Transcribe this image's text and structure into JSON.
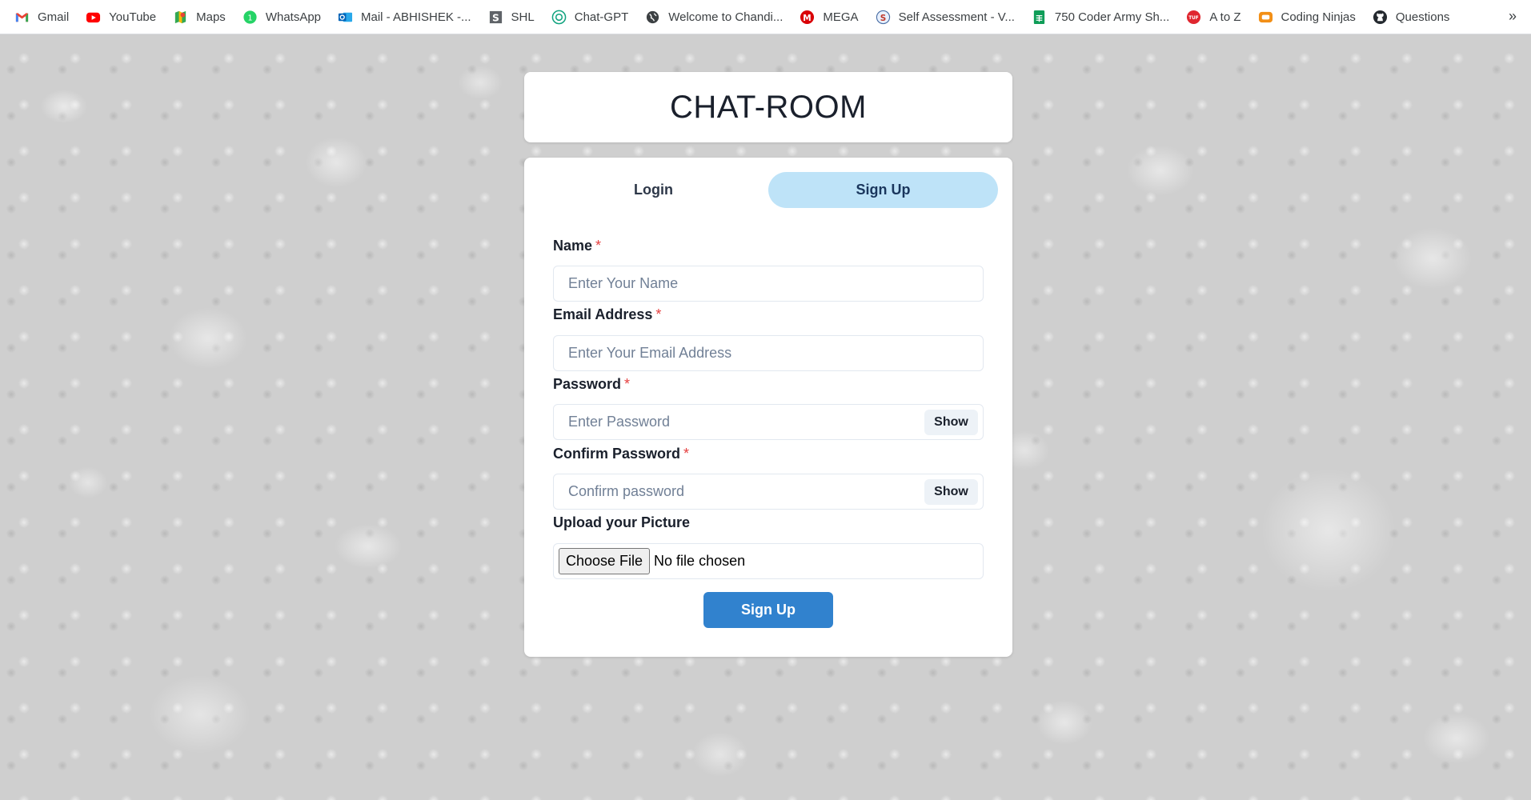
{
  "bookmarks": [
    {
      "label": "Gmail",
      "icon": "gmail-icon"
    },
    {
      "label": "YouTube",
      "icon": "youtube-icon"
    },
    {
      "label": "Maps",
      "icon": "maps-icon"
    },
    {
      "label": "WhatsApp",
      "icon": "whatsapp-icon"
    },
    {
      "label": "Mail - ABHISHEK -...",
      "icon": "outlook-icon"
    },
    {
      "label": "SHL",
      "icon": "shl-icon"
    },
    {
      "label": "Chat-GPT",
      "icon": "chatgpt-icon"
    },
    {
      "label": "Welcome to Chandi...",
      "icon": "globe-icon"
    },
    {
      "label": "MEGA",
      "icon": "mega-icon"
    },
    {
      "label": "Self Assessment - V...",
      "icon": "self-assessment-icon"
    },
    {
      "label": "750 Coder Army Sh...",
      "icon": "sheets-icon"
    },
    {
      "label": "A to Z",
      "icon": "tuf-icon"
    },
    {
      "label": "Coding Ninjas",
      "icon": "coding-ninjas-icon"
    },
    {
      "label": "Questions",
      "icon": "github-icon"
    }
  ],
  "bookmarks_more": "»",
  "header": {
    "title": "CHAT-ROOM"
  },
  "tabs": {
    "login": "Login",
    "signup": "Sign Up",
    "active": "signup"
  },
  "form": {
    "name": {
      "label": "Name",
      "required": "*",
      "placeholder": "Enter Your Name",
      "value": ""
    },
    "email": {
      "label": "Email Address",
      "required": "*",
      "placeholder": "Enter Your Email Address",
      "value": ""
    },
    "password": {
      "label": "Password",
      "required": "*",
      "placeholder": "Enter Password",
      "value": "",
      "toggle": "Show"
    },
    "confirm": {
      "label": "Confirm Password",
      "required": "*",
      "placeholder": "Confirm password",
      "value": "",
      "toggle": "Show"
    },
    "picture": {
      "label": "Upload your Picture",
      "button": "Choose File",
      "status": "No file chosen"
    },
    "submit": "Sign Up"
  },
  "colors": {
    "accent": "#3182ce",
    "active_tab": "#bee3f8",
    "required": "#e53e3e"
  }
}
